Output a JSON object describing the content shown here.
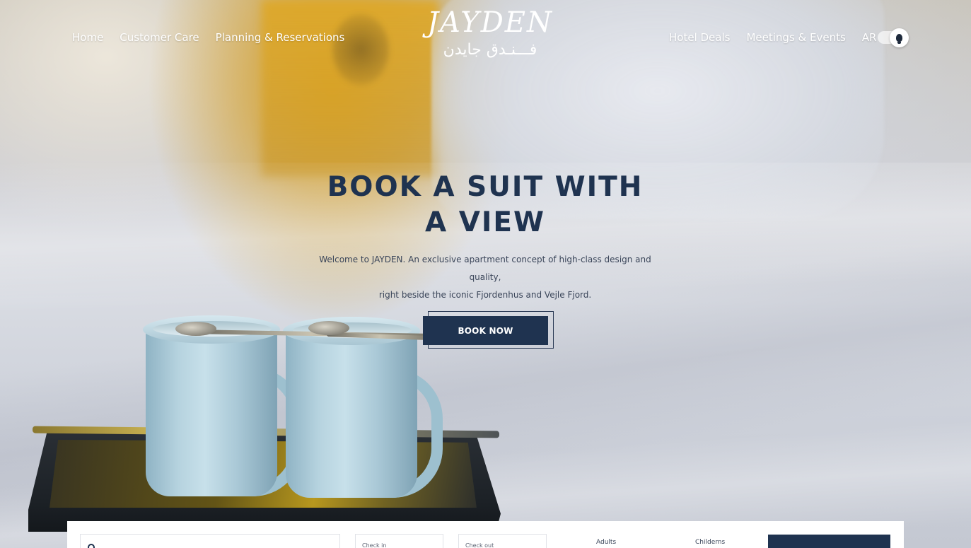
{
  "nav": {
    "left": [
      "Home",
      "Customer Care",
      "Planning & Reservations"
    ],
    "right": [
      "Hotel Deals",
      "Meetings & Events",
      "AR"
    ]
  },
  "logo": {
    "en": "JAYDEN",
    "ar": "فـــنـدق جايدن"
  },
  "hero": {
    "headline_line1": "BOOK A SUIT WITH",
    "headline_line2": "A VIEW",
    "subtext_line1": "Welcome to JAYDEN. An exclusive apartment concept of high-class design and quality,",
    "subtext_line2": "right beside the iconic Fjordenhus and Vejle Fjord.",
    "cta": "BOOK NOW"
  },
  "booking": {
    "check_in_label": "Check in",
    "check_out_label": "Check out",
    "adults_label": "Adults",
    "children_label": "Childerns"
  },
  "theme_toggle": {
    "icon": "lightbulb-icon"
  },
  "colors": {
    "brand_navy": "#1f3350",
    "text_white": "#ffffff"
  }
}
